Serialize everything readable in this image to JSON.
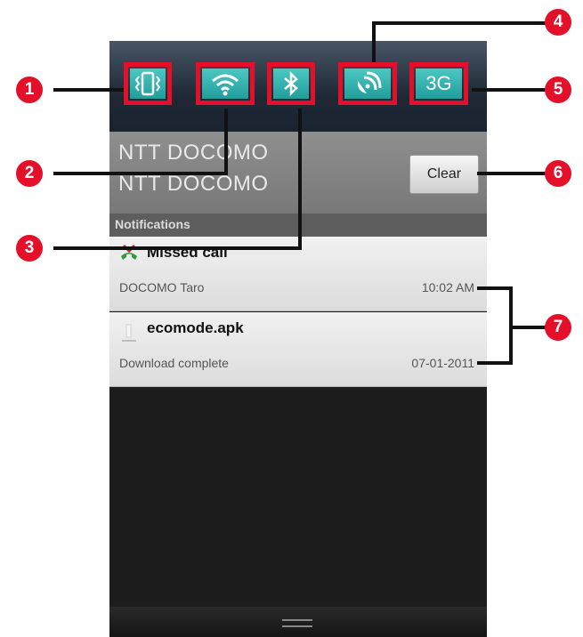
{
  "toggles": [
    {
      "icon": "vibrate-icon",
      "number": "1"
    },
    {
      "icon": "wifi-icon",
      "number": "2"
    },
    {
      "icon": "bluetooth-icon",
      "number": "3"
    },
    {
      "icon": "gps-icon",
      "number": "4"
    },
    {
      "icon": "3g-icon",
      "label": "3G",
      "number": "5"
    }
  ],
  "carrier": {
    "line1": "NTT DOCOMO",
    "line2": "NTT DOCOMO"
  },
  "clear_button": {
    "label": "Clear",
    "number": "6"
  },
  "notifications_header": "Notifications",
  "notifications": [
    {
      "icon": "missed-call-icon",
      "title": "Missed call",
      "subtitle": "DOCOMO Taro",
      "time": "10:02 AM"
    },
    {
      "icon": "download-icon",
      "title": "ecomode.apk",
      "subtitle": "Download complete",
      "time": "07-01-2011"
    }
  ],
  "callout_7": "7",
  "colors": {
    "accent": "#e4102a",
    "toggle": "#1f9e9b"
  }
}
